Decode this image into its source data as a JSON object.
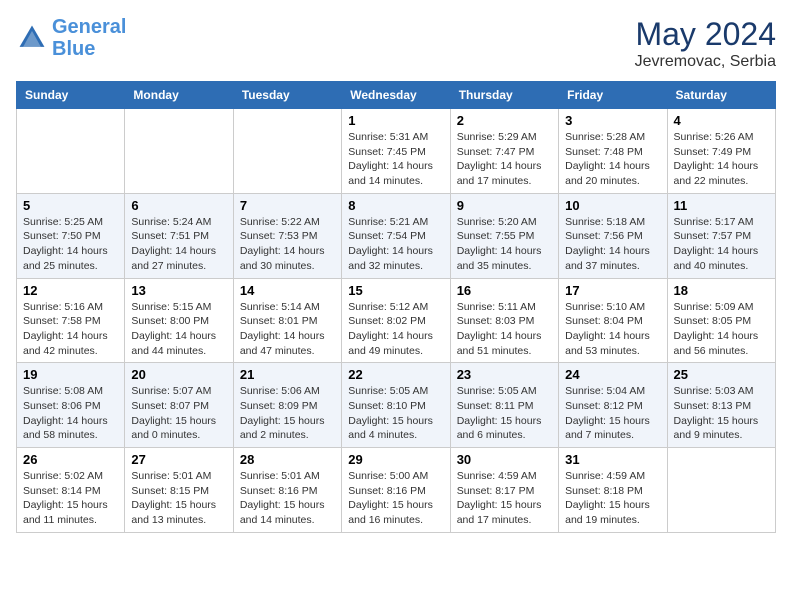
{
  "header": {
    "logo_line1": "General",
    "logo_line2": "Blue",
    "month_year": "May 2024",
    "location": "Jevremovac, Serbia"
  },
  "days_of_week": [
    "Sunday",
    "Monday",
    "Tuesday",
    "Wednesday",
    "Thursday",
    "Friday",
    "Saturday"
  ],
  "weeks": [
    [
      {
        "day": "",
        "info": ""
      },
      {
        "day": "",
        "info": ""
      },
      {
        "day": "",
        "info": ""
      },
      {
        "day": "1",
        "info": "Sunrise: 5:31 AM\nSunset: 7:45 PM\nDaylight: 14 hours and 14 minutes."
      },
      {
        "day": "2",
        "info": "Sunrise: 5:29 AM\nSunset: 7:47 PM\nDaylight: 14 hours and 17 minutes."
      },
      {
        "day": "3",
        "info": "Sunrise: 5:28 AM\nSunset: 7:48 PM\nDaylight: 14 hours and 20 minutes."
      },
      {
        "day": "4",
        "info": "Sunrise: 5:26 AM\nSunset: 7:49 PM\nDaylight: 14 hours and 22 minutes."
      }
    ],
    [
      {
        "day": "5",
        "info": "Sunrise: 5:25 AM\nSunset: 7:50 PM\nDaylight: 14 hours and 25 minutes."
      },
      {
        "day": "6",
        "info": "Sunrise: 5:24 AM\nSunset: 7:51 PM\nDaylight: 14 hours and 27 minutes."
      },
      {
        "day": "7",
        "info": "Sunrise: 5:22 AM\nSunset: 7:53 PM\nDaylight: 14 hours and 30 minutes."
      },
      {
        "day": "8",
        "info": "Sunrise: 5:21 AM\nSunset: 7:54 PM\nDaylight: 14 hours and 32 minutes."
      },
      {
        "day": "9",
        "info": "Sunrise: 5:20 AM\nSunset: 7:55 PM\nDaylight: 14 hours and 35 minutes."
      },
      {
        "day": "10",
        "info": "Sunrise: 5:18 AM\nSunset: 7:56 PM\nDaylight: 14 hours and 37 minutes."
      },
      {
        "day": "11",
        "info": "Sunrise: 5:17 AM\nSunset: 7:57 PM\nDaylight: 14 hours and 40 minutes."
      }
    ],
    [
      {
        "day": "12",
        "info": "Sunrise: 5:16 AM\nSunset: 7:58 PM\nDaylight: 14 hours and 42 minutes."
      },
      {
        "day": "13",
        "info": "Sunrise: 5:15 AM\nSunset: 8:00 PM\nDaylight: 14 hours and 44 minutes."
      },
      {
        "day": "14",
        "info": "Sunrise: 5:14 AM\nSunset: 8:01 PM\nDaylight: 14 hours and 47 minutes."
      },
      {
        "day": "15",
        "info": "Sunrise: 5:12 AM\nSunset: 8:02 PM\nDaylight: 14 hours and 49 minutes."
      },
      {
        "day": "16",
        "info": "Sunrise: 5:11 AM\nSunset: 8:03 PM\nDaylight: 14 hours and 51 minutes."
      },
      {
        "day": "17",
        "info": "Sunrise: 5:10 AM\nSunset: 8:04 PM\nDaylight: 14 hours and 53 minutes."
      },
      {
        "day": "18",
        "info": "Sunrise: 5:09 AM\nSunset: 8:05 PM\nDaylight: 14 hours and 56 minutes."
      }
    ],
    [
      {
        "day": "19",
        "info": "Sunrise: 5:08 AM\nSunset: 8:06 PM\nDaylight: 14 hours and 58 minutes."
      },
      {
        "day": "20",
        "info": "Sunrise: 5:07 AM\nSunset: 8:07 PM\nDaylight: 15 hours and 0 minutes."
      },
      {
        "day": "21",
        "info": "Sunrise: 5:06 AM\nSunset: 8:09 PM\nDaylight: 15 hours and 2 minutes."
      },
      {
        "day": "22",
        "info": "Sunrise: 5:05 AM\nSunset: 8:10 PM\nDaylight: 15 hours and 4 minutes."
      },
      {
        "day": "23",
        "info": "Sunrise: 5:05 AM\nSunset: 8:11 PM\nDaylight: 15 hours and 6 minutes."
      },
      {
        "day": "24",
        "info": "Sunrise: 5:04 AM\nSunset: 8:12 PM\nDaylight: 15 hours and 7 minutes."
      },
      {
        "day": "25",
        "info": "Sunrise: 5:03 AM\nSunset: 8:13 PM\nDaylight: 15 hours and 9 minutes."
      }
    ],
    [
      {
        "day": "26",
        "info": "Sunrise: 5:02 AM\nSunset: 8:14 PM\nDaylight: 15 hours and 11 minutes."
      },
      {
        "day": "27",
        "info": "Sunrise: 5:01 AM\nSunset: 8:15 PM\nDaylight: 15 hours and 13 minutes."
      },
      {
        "day": "28",
        "info": "Sunrise: 5:01 AM\nSunset: 8:16 PM\nDaylight: 15 hours and 14 minutes."
      },
      {
        "day": "29",
        "info": "Sunrise: 5:00 AM\nSunset: 8:16 PM\nDaylight: 15 hours and 16 minutes."
      },
      {
        "day": "30",
        "info": "Sunrise: 4:59 AM\nSunset: 8:17 PM\nDaylight: 15 hours and 17 minutes."
      },
      {
        "day": "31",
        "info": "Sunrise: 4:59 AM\nSunset: 8:18 PM\nDaylight: 15 hours and 19 minutes."
      },
      {
        "day": "",
        "info": ""
      }
    ]
  ]
}
